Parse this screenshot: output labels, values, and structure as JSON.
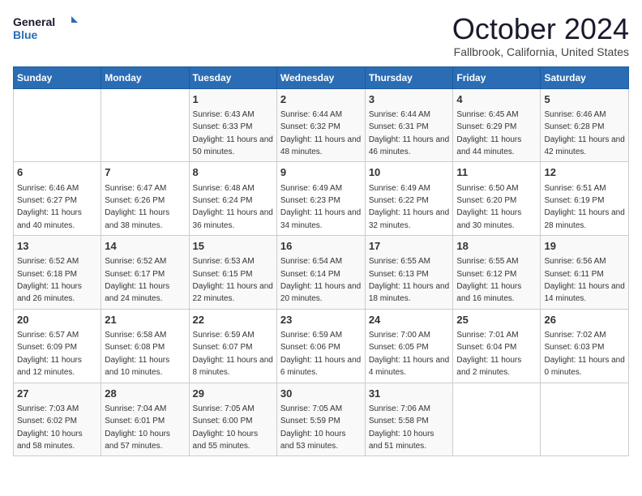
{
  "header": {
    "logo_line1": "General",
    "logo_line2": "Blue",
    "month": "October 2024",
    "location": "Fallbrook, California, United States"
  },
  "days_of_week": [
    "Sunday",
    "Monday",
    "Tuesday",
    "Wednesday",
    "Thursday",
    "Friday",
    "Saturday"
  ],
  "weeks": [
    [
      {
        "day": "",
        "info": ""
      },
      {
        "day": "",
        "info": ""
      },
      {
        "day": "1",
        "info": "Sunrise: 6:43 AM\nSunset: 6:33 PM\nDaylight: 11 hours and 50 minutes."
      },
      {
        "day": "2",
        "info": "Sunrise: 6:44 AM\nSunset: 6:32 PM\nDaylight: 11 hours and 48 minutes."
      },
      {
        "day": "3",
        "info": "Sunrise: 6:44 AM\nSunset: 6:31 PM\nDaylight: 11 hours and 46 minutes."
      },
      {
        "day": "4",
        "info": "Sunrise: 6:45 AM\nSunset: 6:29 PM\nDaylight: 11 hours and 44 minutes."
      },
      {
        "day": "5",
        "info": "Sunrise: 6:46 AM\nSunset: 6:28 PM\nDaylight: 11 hours and 42 minutes."
      }
    ],
    [
      {
        "day": "6",
        "info": "Sunrise: 6:46 AM\nSunset: 6:27 PM\nDaylight: 11 hours and 40 minutes."
      },
      {
        "day": "7",
        "info": "Sunrise: 6:47 AM\nSunset: 6:26 PM\nDaylight: 11 hours and 38 minutes."
      },
      {
        "day": "8",
        "info": "Sunrise: 6:48 AM\nSunset: 6:24 PM\nDaylight: 11 hours and 36 minutes."
      },
      {
        "day": "9",
        "info": "Sunrise: 6:49 AM\nSunset: 6:23 PM\nDaylight: 11 hours and 34 minutes."
      },
      {
        "day": "10",
        "info": "Sunrise: 6:49 AM\nSunset: 6:22 PM\nDaylight: 11 hours and 32 minutes."
      },
      {
        "day": "11",
        "info": "Sunrise: 6:50 AM\nSunset: 6:20 PM\nDaylight: 11 hours and 30 minutes."
      },
      {
        "day": "12",
        "info": "Sunrise: 6:51 AM\nSunset: 6:19 PM\nDaylight: 11 hours and 28 minutes."
      }
    ],
    [
      {
        "day": "13",
        "info": "Sunrise: 6:52 AM\nSunset: 6:18 PM\nDaylight: 11 hours and 26 minutes."
      },
      {
        "day": "14",
        "info": "Sunrise: 6:52 AM\nSunset: 6:17 PM\nDaylight: 11 hours and 24 minutes."
      },
      {
        "day": "15",
        "info": "Sunrise: 6:53 AM\nSunset: 6:15 PM\nDaylight: 11 hours and 22 minutes."
      },
      {
        "day": "16",
        "info": "Sunrise: 6:54 AM\nSunset: 6:14 PM\nDaylight: 11 hours and 20 minutes."
      },
      {
        "day": "17",
        "info": "Sunrise: 6:55 AM\nSunset: 6:13 PM\nDaylight: 11 hours and 18 minutes."
      },
      {
        "day": "18",
        "info": "Sunrise: 6:55 AM\nSunset: 6:12 PM\nDaylight: 11 hours and 16 minutes."
      },
      {
        "day": "19",
        "info": "Sunrise: 6:56 AM\nSunset: 6:11 PM\nDaylight: 11 hours and 14 minutes."
      }
    ],
    [
      {
        "day": "20",
        "info": "Sunrise: 6:57 AM\nSunset: 6:09 PM\nDaylight: 11 hours and 12 minutes."
      },
      {
        "day": "21",
        "info": "Sunrise: 6:58 AM\nSunset: 6:08 PM\nDaylight: 11 hours and 10 minutes."
      },
      {
        "day": "22",
        "info": "Sunrise: 6:59 AM\nSunset: 6:07 PM\nDaylight: 11 hours and 8 minutes."
      },
      {
        "day": "23",
        "info": "Sunrise: 6:59 AM\nSunset: 6:06 PM\nDaylight: 11 hours and 6 minutes."
      },
      {
        "day": "24",
        "info": "Sunrise: 7:00 AM\nSunset: 6:05 PM\nDaylight: 11 hours and 4 minutes."
      },
      {
        "day": "25",
        "info": "Sunrise: 7:01 AM\nSunset: 6:04 PM\nDaylight: 11 hours and 2 minutes."
      },
      {
        "day": "26",
        "info": "Sunrise: 7:02 AM\nSunset: 6:03 PM\nDaylight: 11 hours and 0 minutes."
      }
    ],
    [
      {
        "day": "27",
        "info": "Sunrise: 7:03 AM\nSunset: 6:02 PM\nDaylight: 10 hours and 58 minutes."
      },
      {
        "day": "28",
        "info": "Sunrise: 7:04 AM\nSunset: 6:01 PM\nDaylight: 10 hours and 57 minutes."
      },
      {
        "day": "29",
        "info": "Sunrise: 7:05 AM\nSunset: 6:00 PM\nDaylight: 10 hours and 55 minutes."
      },
      {
        "day": "30",
        "info": "Sunrise: 7:05 AM\nSunset: 5:59 PM\nDaylight: 10 hours and 53 minutes."
      },
      {
        "day": "31",
        "info": "Sunrise: 7:06 AM\nSunset: 5:58 PM\nDaylight: 10 hours and 51 minutes."
      },
      {
        "day": "",
        "info": ""
      },
      {
        "day": "",
        "info": ""
      }
    ]
  ]
}
